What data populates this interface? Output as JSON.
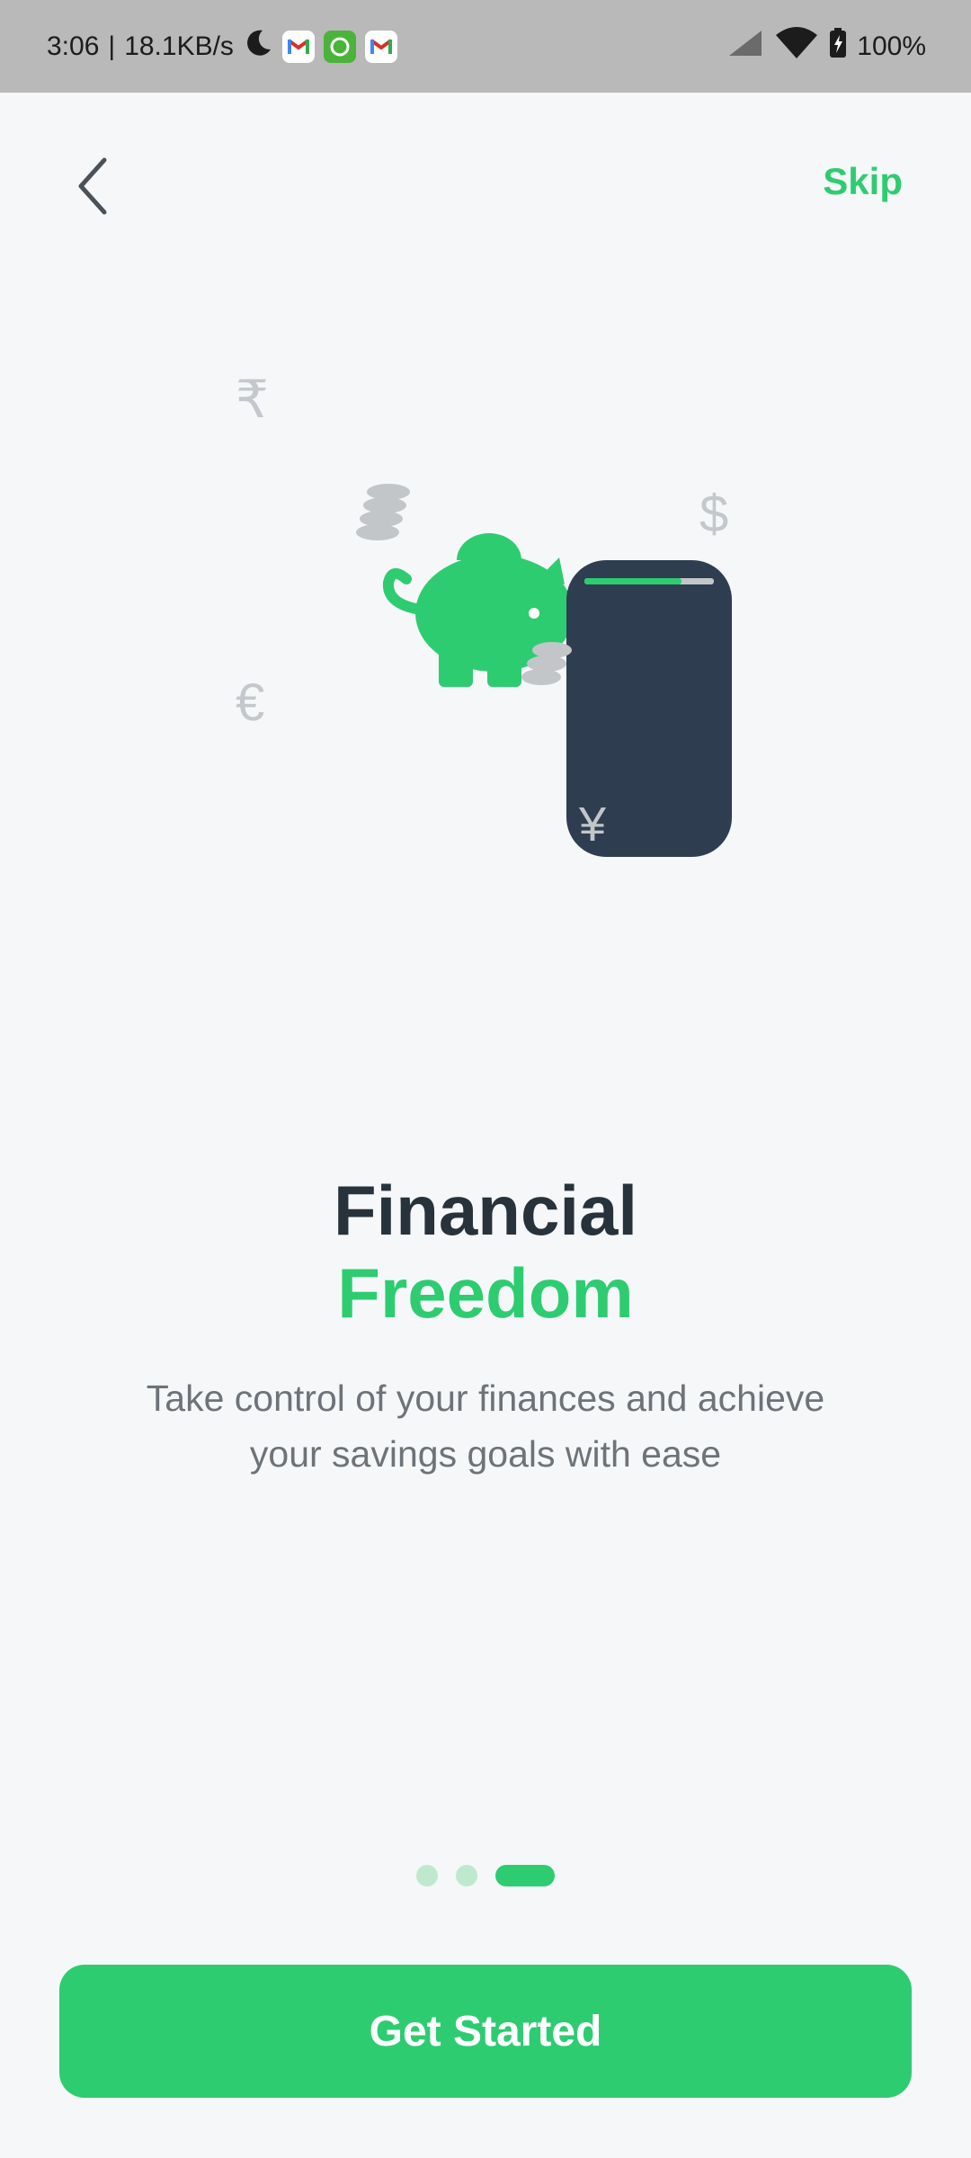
{
  "status_bar": {
    "time": "3:06",
    "separator": "|",
    "speed": "18.1KB/s",
    "battery": "100%"
  },
  "nav": {
    "skip_label": "Skip"
  },
  "illustration": {
    "currency_symbols": {
      "rupee": "₹",
      "dollar": "$",
      "euro": "€",
      "yen": "¥"
    },
    "phone_progress_fraction": 0.75,
    "colors": {
      "accent": "#2ecc71",
      "phone": "#2e3d50",
      "coins": "#c3c6c9"
    }
  },
  "hero": {
    "title_line1": "Financial",
    "title_line2": "Freedom",
    "subtitle": "Take control of your finances and achieve your savings goals with ease"
  },
  "pagination": {
    "total_pages": 3,
    "active_page": 3
  },
  "cta": {
    "label": "Get Started"
  },
  "colors": {
    "brand": "#2ecc71",
    "title": "#27323a",
    "subtitle": "#6d7378",
    "background": "#f6f7f9"
  }
}
